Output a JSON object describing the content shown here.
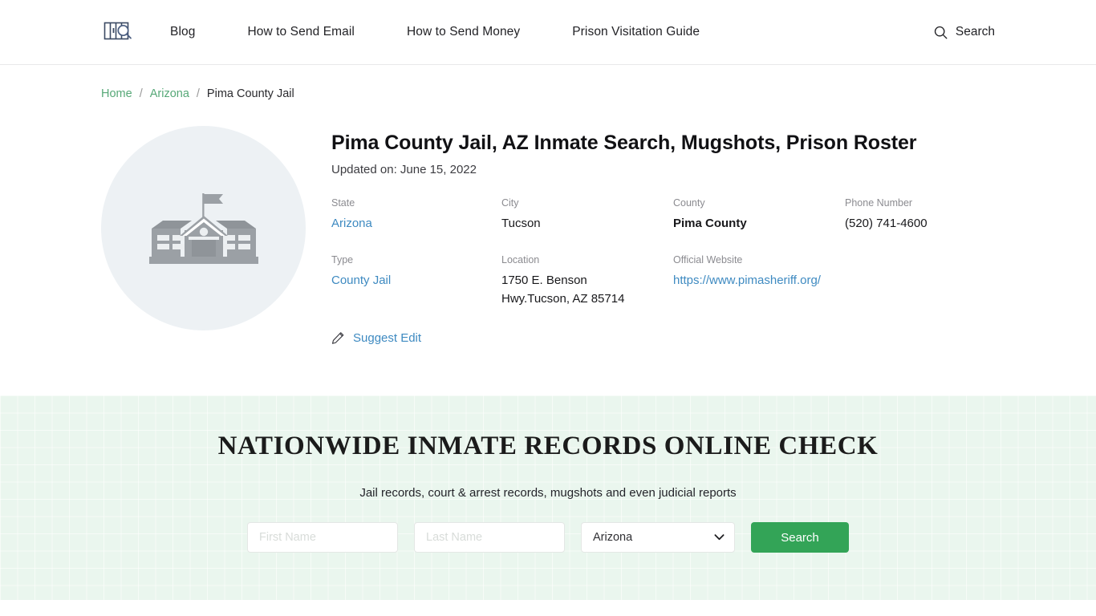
{
  "header": {
    "logo_alt": "jail-bars-magnifier-logo",
    "nav_items": [
      {
        "label": "Blog"
      },
      {
        "label": "How to Send Email"
      },
      {
        "label": "How to Send Money"
      },
      {
        "label": "Prison Visitation Guide"
      }
    ],
    "search_label": "Search"
  },
  "breadcrumb": {
    "home": "Home",
    "sep": "/",
    "state": "Arizona",
    "current": "Pima County Jail"
  },
  "facility": {
    "image_alt": "government-building-placeholder",
    "title": "Pima County Jail, AZ Inmate Search, Mugshots, Prison Roster",
    "updated": "Updated on: June 15, 2022",
    "fields": [
      {
        "label": "State",
        "value": "Arizona",
        "link": true,
        "bold": false
      },
      {
        "label": "City",
        "value": "Tucson",
        "link": false,
        "bold": false
      },
      {
        "label": "County",
        "value": "Pima County",
        "link": false,
        "bold": true
      },
      {
        "label": "Phone Number",
        "value": "(520) 741-4600",
        "link": false,
        "bold": false
      },
      {
        "label": "Type",
        "value": "County Jail",
        "link": true,
        "bold": false
      },
      {
        "label": "Location",
        "value": "1750 E. Benson Hwy.Tucson, AZ 85714",
        "link": false,
        "bold": false
      },
      {
        "label": "Official Website",
        "value": "https://www.pimasheriff.org/",
        "link": true,
        "bold": false
      },
      {
        "label": "",
        "value": "",
        "link": false,
        "bold": false
      }
    ],
    "suggest_edit": "Suggest Edit"
  },
  "search_panel": {
    "title": "NATIONWIDE INMATE RECORDS ONLINE CHECK",
    "subtitle": "Jail records, court & arrest records, mugshots and even judicial reports",
    "first_name_placeholder": "First Name",
    "first_name_value": "",
    "last_name_placeholder": "Last Name",
    "last_name_value": "",
    "state_selected": "Arizona",
    "state_options": [
      "Arizona"
    ],
    "button_label": "Search"
  },
  "colors": {
    "accent_green": "#33a457",
    "link_blue": "#3e8ac1",
    "breadcrumb_green": "#56a877",
    "panel_bg": "#eaf6ee"
  }
}
